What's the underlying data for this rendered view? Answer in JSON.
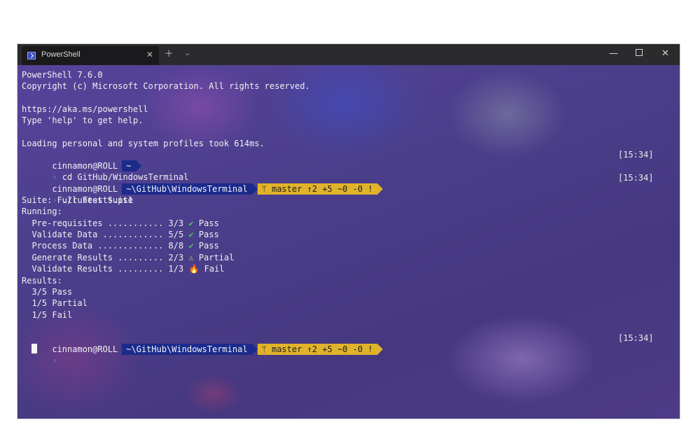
{
  "window": {
    "tab_title": "PowerShell",
    "tab_close": "✕",
    "new_tab": "+",
    "dropdown": "⌄",
    "minimize": "—",
    "close": "✕"
  },
  "terminal": {
    "header": [
      "PowerShell 7.6.0",
      "Copyright (c) Microsoft Corporation. All rights reserved.",
      "",
      "https://aka.ms/powershell",
      "Type 'help' to get help.",
      "",
      "Loading personal and system profiles took 614ms."
    ],
    "prompt1": {
      "user": "cinnamon@ROLL",
      "path": "~",
      "time": "[15:34]",
      "chevron": "›",
      "command": "cd GitHub/WindowsTerminal"
    },
    "prompt2": {
      "user": "cinnamon@ROLL",
      "path": "~\\GitHub\\WindowsTerminal",
      "git": "ᛘ master ↑2 +5 ~0 -0 !",
      "time": "[15:34]",
      "chevron": "›",
      "command": "./runtests.ps1"
    },
    "suite_line": "Suite: Full Test Suite",
    "running_line": "Running:",
    "tests": [
      {
        "label": "Pre-requisites ........... 3/3",
        "symbol": "✔",
        "status": "Pass",
        "kind": "check"
      },
      {
        "label": "Validate Data ............ 5/5",
        "symbol": "✔",
        "status": "Pass",
        "kind": "check"
      },
      {
        "label": "Process Data ............. 8/8",
        "symbol": "✔",
        "status": "Pass",
        "kind": "check"
      },
      {
        "label": "Generate Results ......... 2/3",
        "symbol": "⚠",
        "status": "Partial",
        "kind": "warn"
      },
      {
        "label": "Validate Results ......... 1/3",
        "symbol": "🔥",
        "status": "Fail",
        "kind": "fire"
      }
    ],
    "results_line": "Results:",
    "results": [
      "3/5 Pass",
      "1/5 Partial",
      "1/5 Fail"
    ],
    "prompt3": {
      "user": "cinnamon@ROLL",
      "path": "~\\GitHub\\WindowsTerminal",
      "git": "ᛘ master ↑2 +5 ~0 -0 !",
      "time": "[15:34]",
      "chevron": "›"
    }
  }
}
